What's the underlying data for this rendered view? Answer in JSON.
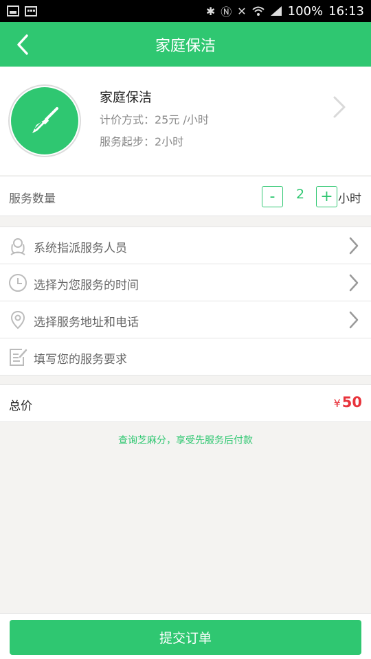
{
  "status_bar": {
    "battery": "100%",
    "time": "16:13"
  },
  "app_bar": {
    "title": "家庭保洁"
  },
  "service": {
    "name": "家庭保洁",
    "price": "计价方式：25元 /小时",
    "minimum": "服务起步：2小时",
    "icon": "broom-icon"
  },
  "quantity": {
    "label": "服务数量",
    "minus": "-",
    "value": "2",
    "plus": "+",
    "unit": "小时"
  },
  "options": [
    {
      "label": "系统指派服务人员",
      "icon": "staff-icon"
    },
    {
      "label": "选择为您服务的时间",
      "icon": "clock-icon"
    },
    {
      "label": "选择服务地址和电话",
      "icon": "location-icon"
    },
    {
      "label": "填写您的服务要求",
      "icon": "edit-note-icon"
    }
  ],
  "total": {
    "label": "总价",
    "currency": "¥",
    "value": "50"
  },
  "zhima_link": "查询芝麻分，享受先服务后付款",
  "submit_label": "提交订单",
  "colors": {
    "brand_green": "#2fc771",
    "price_red": "#e8343c",
    "background": "#f4f3f1"
  }
}
